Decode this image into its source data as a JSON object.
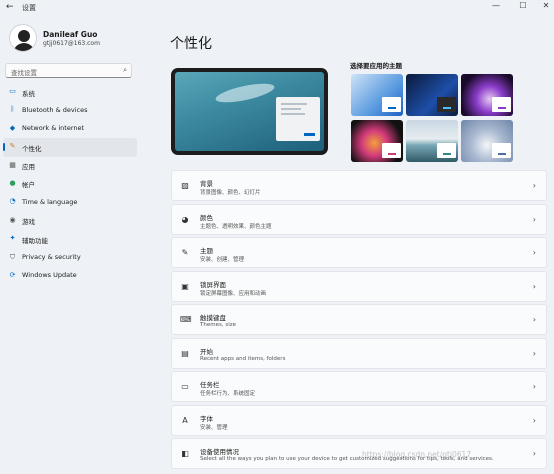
{
  "window": {
    "title": "设置",
    "back": "←",
    "minimize": "—",
    "maximize": "☐",
    "close": "✕"
  },
  "profile": {
    "name": "Danileaf Guo",
    "email": "gtjj0617@163.com"
  },
  "search": {
    "placeholder": "查找设置",
    "icon": "⌕"
  },
  "sidebar": {
    "items": [
      {
        "label": "系统",
        "icon": "monitor-icon",
        "glyph": "▭",
        "color": "#0067c0"
      },
      {
        "label": "Bluetooth & devices",
        "icon": "bluetooth-icon",
        "glyph": "ᛒ",
        "color": "#0067c0"
      },
      {
        "label": "Network & internet",
        "icon": "wifi-icon",
        "glyph": "◆",
        "color": "#0067c0"
      },
      {
        "label": "个性化",
        "icon": "brush-icon",
        "glyph": "✎",
        "color": "#c87a2b"
      },
      {
        "label": "应用",
        "icon": "apps-icon",
        "glyph": "▦",
        "color": "#555555"
      },
      {
        "label": "帐户",
        "icon": "person-icon",
        "glyph": "●",
        "color": "#2e9e5b"
      },
      {
        "label": "Time & language",
        "icon": "clock-globe-icon",
        "glyph": "◔",
        "color": "#0067c0"
      },
      {
        "label": "游戏",
        "icon": "gamepad-icon",
        "glyph": "◉",
        "color": "#555555"
      },
      {
        "label": "辅助功能",
        "icon": "accessibility-icon",
        "glyph": "✦",
        "color": "#0067c0"
      },
      {
        "label": "Privacy & security",
        "icon": "shield-icon",
        "glyph": "⛉",
        "color": "#555555"
      },
      {
        "label": "Windows Update",
        "icon": "update-icon",
        "glyph": "⟳",
        "color": "#0067c0"
      }
    ],
    "active_index": 3
  },
  "main": {
    "title": "个性化",
    "theme_section_label": "选择要应用的主题",
    "themes": [
      {
        "name": "windows-light",
        "bg": "linear-gradient(135deg,#cfe3f7,#5b9be0 60%,#1d5fc7)",
        "dark": false,
        "accent": "#0067c0"
      },
      {
        "name": "windows-dark",
        "bg": "linear-gradient(135deg,#0a1a3a,#1e4ea8 60%,#0a1a3a)",
        "dark": true,
        "accent": "#4cc2ff"
      },
      {
        "name": "glow",
        "bg": "radial-gradient(circle at 55% 60%,#e6c8f0 0%,#8a3cc9 35%,#1a0a2a 75%)",
        "dark": false,
        "accent": "#8a3cc9"
      },
      {
        "name": "captured-motion",
        "bg": "radial-gradient(circle at 45% 55%,#f2a03c 0%,#d23a7a 35%,#111111 75%)",
        "dark": false,
        "accent": "#d23a7a"
      },
      {
        "name": "sunrise",
        "bg": "linear-gradient(180deg,#c9d7e3 0%,#e6ecf0 45%,#7aa7b5 60%,#2f5a66 100%)",
        "dark": false,
        "accent": "#2f8a8a"
      },
      {
        "name": "flow",
        "bg": "radial-gradient(circle at 50% 60%,#f4f6f9 0%,#a8b8d0 45%,#6e84a8 100%)",
        "dark": false,
        "accent": "#4a6fa5"
      }
    ],
    "cards": [
      {
        "title": "背景",
        "subtitle": "背景图像、颜色、幻灯片",
        "icon": "image-icon",
        "glyph": "▨"
      },
      {
        "title": "颜色",
        "subtitle": "主题色、透明效果、颜色主题",
        "icon": "palette-icon",
        "glyph": "◕"
      },
      {
        "title": "主题",
        "subtitle": "安装、创建、管理",
        "icon": "pen-icon",
        "glyph": "✎"
      },
      {
        "title": "锁屏界面",
        "subtitle": "锁定屏幕图像、应用和动画",
        "icon": "lock-screen-icon",
        "glyph": "▣"
      },
      {
        "title": "触摸键盘",
        "subtitle": "Themes, size",
        "icon": "keyboard-icon",
        "glyph": "⌨"
      },
      {
        "title": "开始",
        "subtitle": "Recent apps and items, folders",
        "icon": "start-icon",
        "glyph": "▤"
      },
      {
        "title": "任务栏",
        "subtitle": "任务栏行为、系统固定",
        "icon": "taskbar-icon",
        "glyph": "▭"
      },
      {
        "title": "字体",
        "subtitle": "安装、管理",
        "icon": "font-icon",
        "glyph": "A"
      },
      {
        "title": "设备使用情况",
        "subtitle": "Select all the ways you plan to use your device to get customized suggestions for tips, tools, and services.",
        "icon": "device-usage-icon",
        "glyph": "◧"
      }
    ],
    "chevron": "›"
  },
  "watermark": "https://blog.csdn.net/gtj0617"
}
